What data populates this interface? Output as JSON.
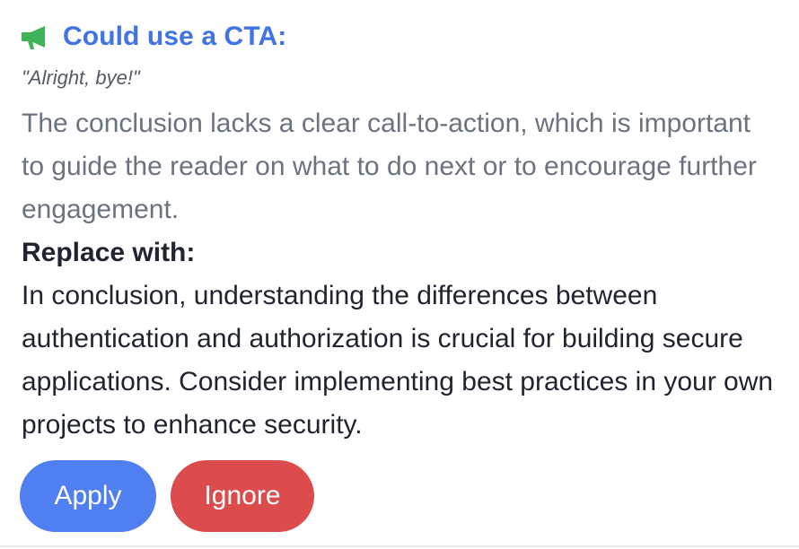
{
  "suggestion": {
    "icon": "megaphone-icon",
    "title": "Could use a CTA:",
    "quote": "\"Alright, bye!\"",
    "explanation": "The conclusion lacks a clear call-to-action, which is important to guide the reader on what to do next or to encourage further engagement.",
    "replace_label": "Replace with:",
    "replacement_text": "In conclusion, understanding the differences between authentication and authorization is crucial for building secure applications. Consider implementing best practices in your own projects to enhance security."
  },
  "actions": {
    "apply_label": "Apply",
    "ignore_label": "Ignore"
  },
  "colors": {
    "accent": "#3f73e6",
    "icon": "#3db35a",
    "apply": "#4f7ff0",
    "ignore": "#dc4c4c",
    "muted_text": "#6b7280"
  }
}
